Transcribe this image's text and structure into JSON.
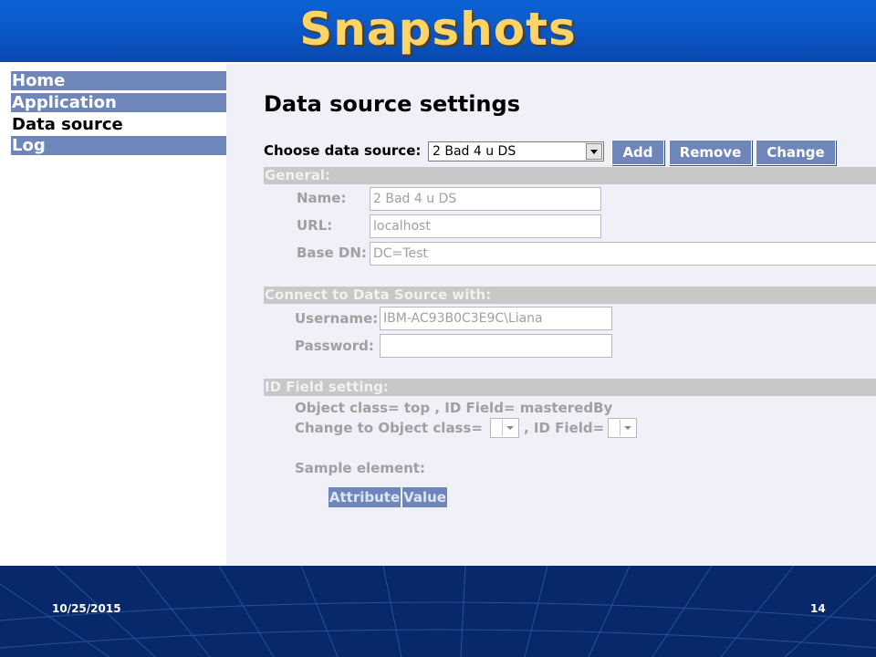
{
  "slide": {
    "title": "Snapshots",
    "date": "10/25/2015",
    "page_number": "14"
  },
  "nav": {
    "items": [
      {
        "label": "Home",
        "active": false
      },
      {
        "label": "Application",
        "active": false
      },
      {
        "label": "Data source",
        "active": true
      },
      {
        "label": "Log",
        "active": false
      }
    ]
  },
  "main": {
    "title": "Data source settings",
    "choose_label": "Choose data source:",
    "selected_source": "2 Bad 4 u DS",
    "buttons": {
      "add": "Add",
      "remove": "Remove",
      "change": "Change"
    },
    "general": {
      "header": "General:",
      "name_label": "Name:",
      "name_value": "2 Bad 4 u DS",
      "url_label": "URL:",
      "url_value": "localhost",
      "basedn_label": "Base DN:",
      "basedn_value": "DC=Test"
    },
    "connect": {
      "header": "Connect to Data Source with:",
      "username_label": "Username:",
      "username_value": "IBM-AC93B0C3E9C\\Liana",
      "password_label": "Password:",
      "password_value": ""
    },
    "idfield": {
      "header": "ID Field setting:",
      "object_line": "Object class= top , ID Field= masteredBy",
      "change_prefix": "Change to Object class=",
      "change_middle": ", ID Field=",
      "sample_label": "Sample element:",
      "table_headers": [
        "Attribute",
        "Value"
      ]
    }
  },
  "colors": {
    "nav_bg": "#6f86bb",
    "title_gold": "#ffd466",
    "slide_blue": "#0a55c4",
    "panel_bg": "#eff0f8"
  }
}
